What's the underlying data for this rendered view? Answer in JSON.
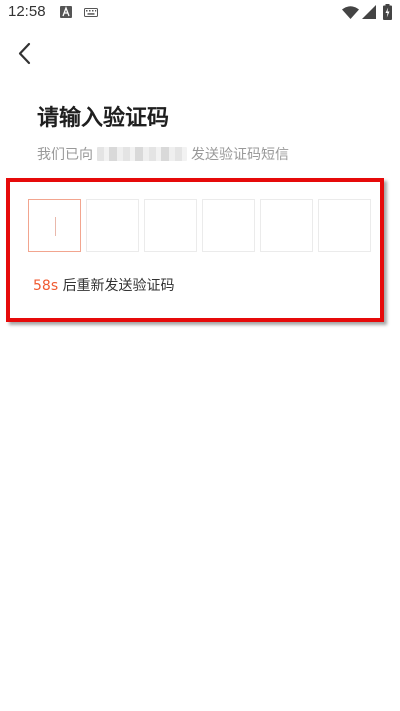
{
  "status_bar": {
    "time": "12:58"
  },
  "header": {
    "back_icon": "back-arrow-icon",
    "title": "请输入验证码"
  },
  "subtitle": {
    "prefix": "我们已向",
    "suffix": "发送验证码短信"
  },
  "code_input": {
    "boxes": [
      "",
      "",
      "",
      "",
      "",
      ""
    ]
  },
  "resend": {
    "countdown": "58s",
    "text": "后重新发送验证码"
  },
  "colors": {
    "accent": "#f05a30",
    "highlight": "#e60a0a"
  }
}
